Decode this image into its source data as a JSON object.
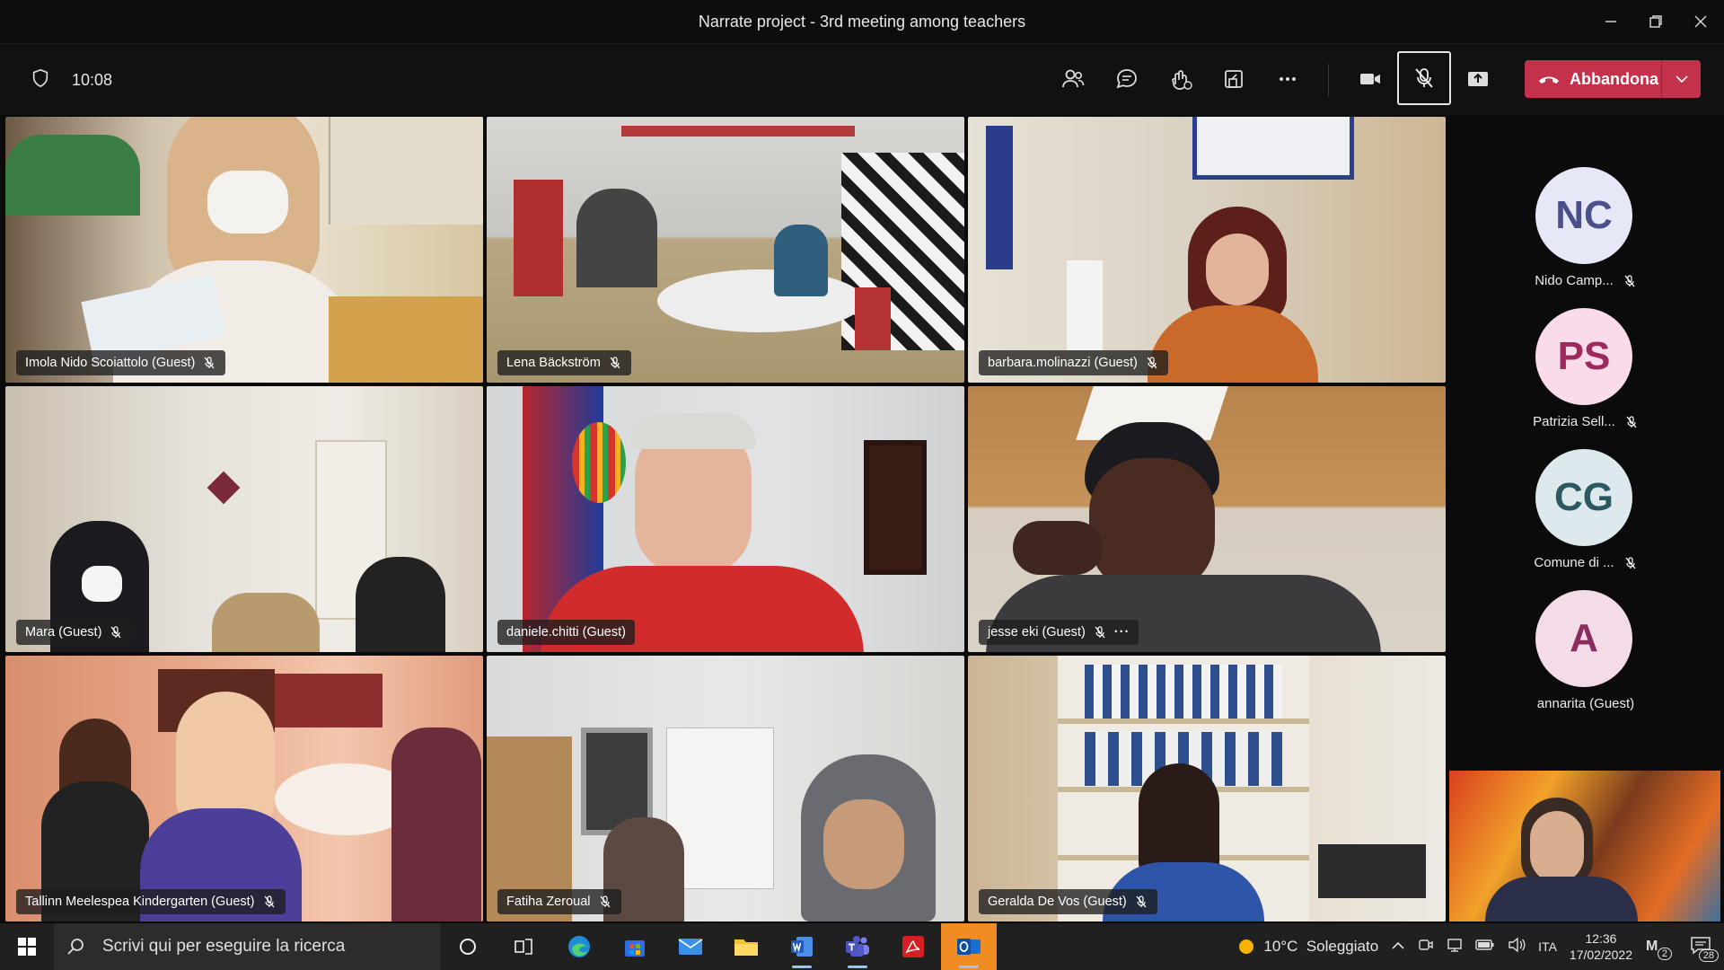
{
  "window": {
    "title": "Narrate project - 3rd meeting among teachers"
  },
  "toolbar": {
    "time": "10:08",
    "leave_label": "Abbandona",
    "icons": [
      "shield-icon",
      "people-icon",
      "chat-icon",
      "reactions-icon",
      "rooms-icon",
      "more-icon",
      "camera-icon",
      "mic-off-icon",
      "share-icon",
      "phone-icon",
      "chevron-down-icon"
    ]
  },
  "participants": [
    {
      "name": "Imola Nido Scoiattolo (Guest)",
      "muted": true
    },
    {
      "name": "Lena Bäckström",
      "muted": true
    },
    {
      "name": "barbara.molinazzi (Guest)",
      "muted": true
    },
    {
      "name": "Mara (Guest)",
      "muted": true
    },
    {
      "name": "daniele.chitti (Guest)",
      "muted": false,
      "speaking": true
    },
    {
      "name": "jesse eki (Guest)",
      "muted": true,
      "more": "···"
    },
    {
      "name": "Tallinn Meelespea Kindergarten (Guest)",
      "muted": true
    },
    {
      "name": "Fatiha Zeroual",
      "muted": true
    },
    {
      "name": "Geralda De Vos (Guest)",
      "muted": true
    }
  ],
  "side_participants": [
    {
      "initials": "NC",
      "name": "Nido Camp...",
      "bg": "#e7e8f7",
      "fg": "#4b4f8a"
    },
    {
      "initials": "PS",
      "name": "Patrizia Sell...",
      "bg": "#f9dbe9",
      "fg": "#9c2a5d"
    },
    {
      "initials": "CG",
      "name": "Comune di ...",
      "bg": "#dde9ec",
      "fg": "#2c5862"
    },
    {
      "initials": "A",
      "name": "annarita (Guest)",
      "bg": "#f3dbe8",
      "fg": "#8a2c5e"
    }
  ],
  "taskbar": {
    "search_placeholder": "Scrivi qui per eseguire la ricerca",
    "weather": "10°C  Soleggiato",
    "language": "ITA",
    "time": "12:36",
    "date": "17/02/2022",
    "notification_count": "28",
    "badge_count": "2",
    "apps": [
      "cortana-icon",
      "task-view-icon",
      "edge-icon",
      "store-icon",
      "mail-icon",
      "file-explorer-icon",
      "word-icon",
      "teams-icon",
      "acrobat-icon",
      "outlook-icon"
    ]
  },
  "colors": {
    "leave": "#c4314b",
    "active_speaker": "#8c8fe8"
  }
}
